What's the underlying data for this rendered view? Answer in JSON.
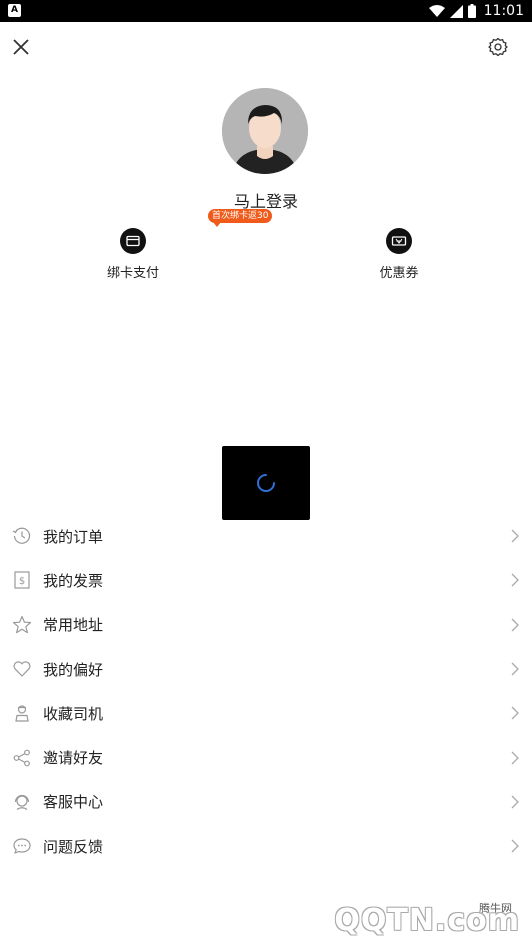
{
  "status_bar": {
    "time": "11:01"
  },
  "profile": {
    "login_label": "马上登录",
    "promo_badge": "首次绑卡返30"
  },
  "quick_actions": [
    {
      "label": "绑卡支付",
      "icon": "card-icon"
    },
    {
      "label": "优惠券",
      "icon": "coupon-icon"
    }
  ],
  "menu": [
    {
      "label": "我的订单",
      "icon": "clock-icon"
    },
    {
      "label": "我的发票",
      "icon": "invoice-icon"
    },
    {
      "label": "常用地址",
      "icon": "star-icon"
    },
    {
      "label": "我的偏好",
      "icon": "heart-icon"
    },
    {
      "label": "收藏司机",
      "icon": "driver-icon"
    },
    {
      "label": "邀请好友",
      "icon": "share-icon"
    },
    {
      "label": "客服中心",
      "icon": "headset-icon"
    },
    {
      "label": "问题反馈",
      "icon": "chat-icon"
    }
  ],
  "watermark": {
    "site_label": "腾牛网",
    "logo": "QQTN.com"
  },
  "colors": {
    "promo": "#f05a1a",
    "loading_bg": "#000000",
    "spinner": "#2f6fd6"
  }
}
